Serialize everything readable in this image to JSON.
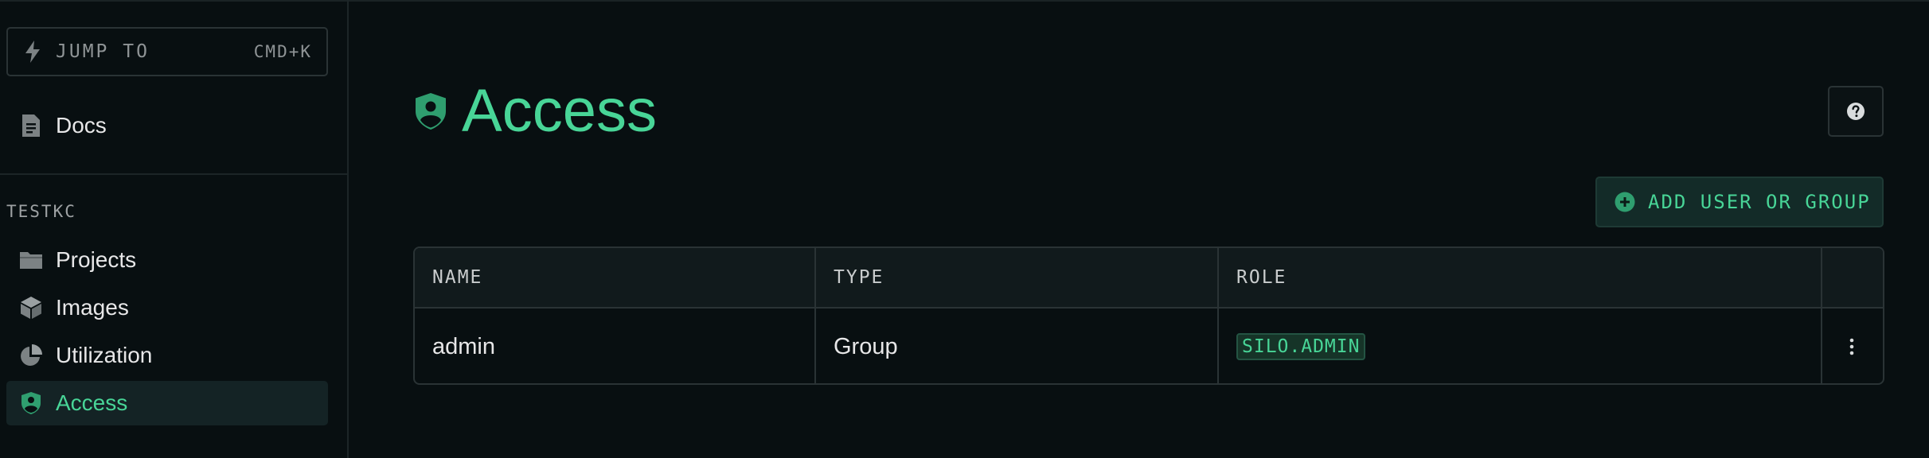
{
  "sidebar": {
    "jump_to": {
      "label": "JUMP TO",
      "shortcut": "CMD+K",
      "icon": "lightning-icon"
    },
    "docs": {
      "label": "Docs",
      "icon": "document-icon"
    },
    "section_label": "TESTKC",
    "items": [
      {
        "label": "Projects",
        "icon": "folder-icon",
        "active": false
      },
      {
        "label": "Images",
        "icon": "cube-icon",
        "active": false
      },
      {
        "label": "Utilization",
        "icon": "pie-chart-icon",
        "active": false
      },
      {
        "label": "Access",
        "icon": "shield-user-icon",
        "active": true
      }
    ]
  },
  "main": {
    "title": "Access",
    "title_icon": "shield-user-icon",
    "help_icon": "question-icon",
    "add_button": {
      "label": "ADD USER OR GROUP",
      "icon": "plus-circle-icon"
    },
    "table": {
      "columns": [
        "NAME",
        "TYPE",
        "ROLE"
      ],
      "rows": [
        {
          "name": "admin",
          "type": "Group",
          "role": "SILO.ADMIN",
          "actions_icon": "more-vertical-icon"
        }
      ]
    }
  },
  "colors": {
    "background": "#080f11",
    "accent": "#48d597",
    "active_bg": "#142325",
    "border": "#2a3335"
  }
}
